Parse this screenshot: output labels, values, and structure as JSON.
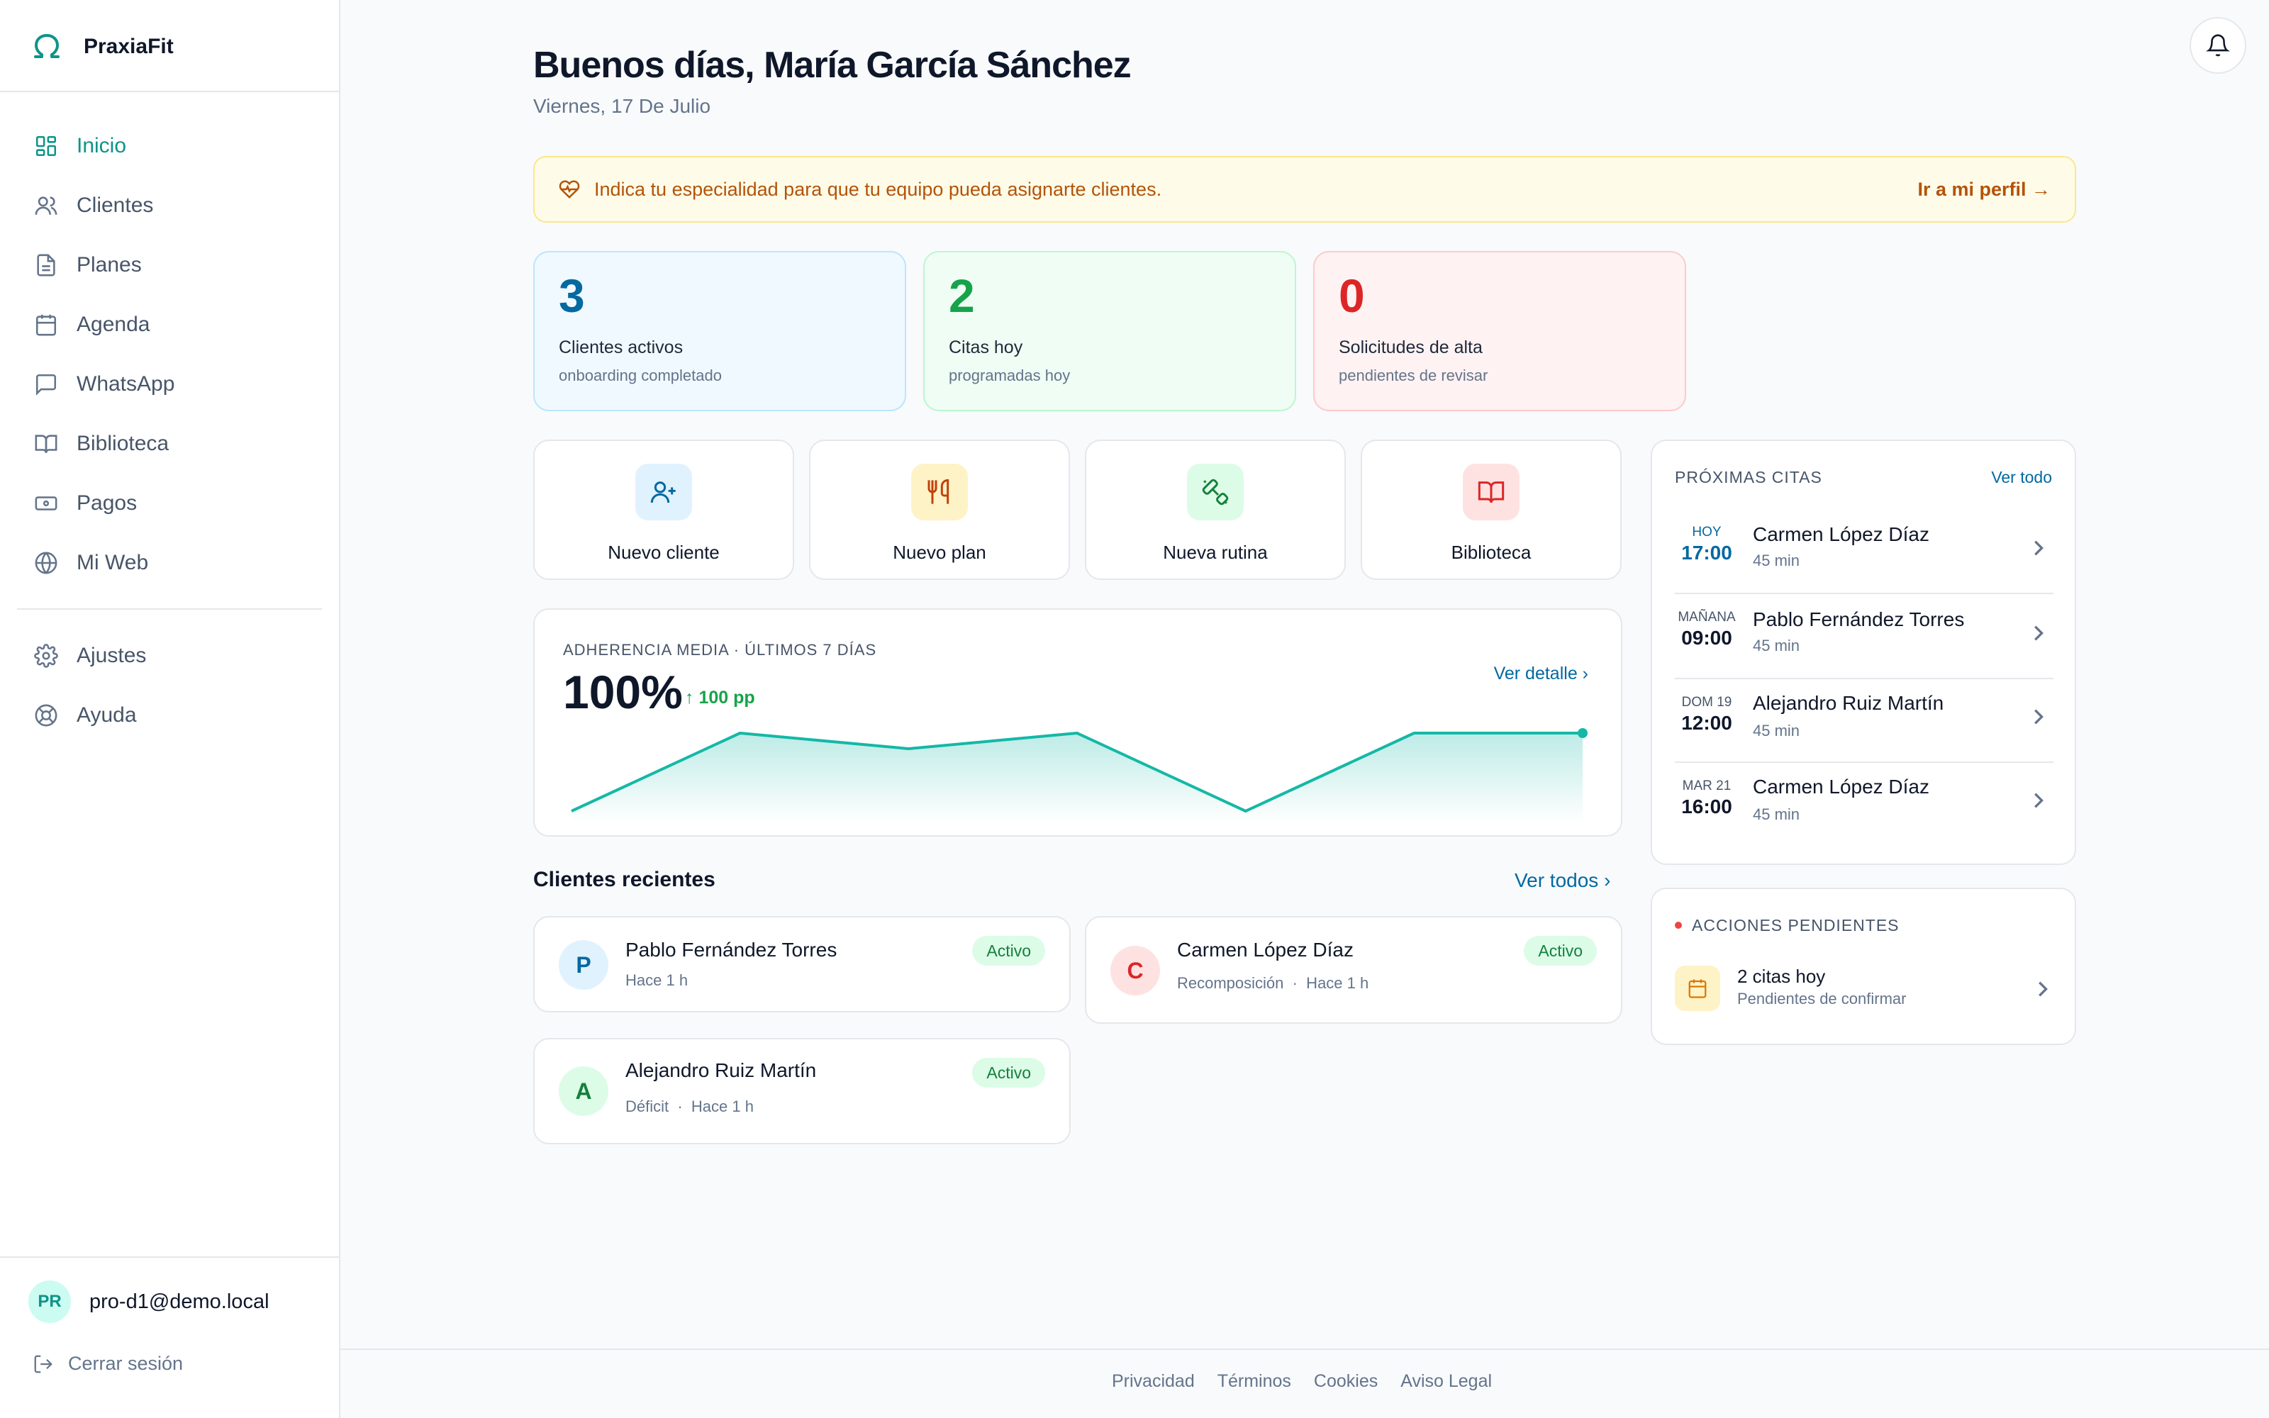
{
  "brand": {
    "name": "PraxiaFit"
  },
  "nav": {
    "items": [
      {
        "label": "Inicio"
      },
      {
        "label": "Clientes"
      },
      {
        "label": "Planes"
      },
      {
        "label": "Agenda"
      },
      {
        "label": "WhatsApp"
      },
      {
        "label": "Biblioteca"
      },
      {
        "label": "Pagos"
      },
      {
        "label": "Mi Web"
      }
    ],
    "secondary": [
      {
        "label": "Ajustes"
      },
      {
        "label": "Ayuda"
      }
    ]
  },
  "user": {
    "initials": "PR",
    "email": "pro-d1@demo.local",
    "logout": "Cerrar sesión"
  },
  "header": {
    "greeting": "Buenos días, María García Sánchez",
    "date": "Viernes, 17 De Julio"
  },
  "banner": {
    "text": "Indica tu especialidad para que tu equipo pueda asignarte clientes.",
    "link": "Ir a mi perfil →"
  },
  "stats": [
    {
      "value": "3",
      "label": "Clientes activos",
      "sub": "onboarding completado",
      "color": "#0369a1"
    },
    {
      "value": "2",
      "label": "Citas hoy",
      "sub": "programadas hoy",
      "color": "#16a34a"
    },
    {
      "value": "0",
      "label": "Solicitudes de alta",
      "sub": "pendientes de revisar",
      "color": "#dc2626"
    }
  ],
  "quick_actions": [
    {
      "label": "Nuevo cliente",
      "icon": "user-plus-icon"
    },
    {
      "label": "Nuevo plan",
      "icon": "utensils-icon"
    },
    {
      "label": "Nueva rutina",
      "icon": "dumbbell-icon"
    },
    {
      "label": "Biblioteca",
      "icon": "book-open-icon"
    }
  ],
  "adherence": {
    "title": "ADHERENCIA MEDIA · ÚLTIMOS 7 DÍAS",
    "value": "100%",
    "delta": "100 pp",
    "link": "Ver detalle"
  },
  "chart_data": {
    "type": "area",
    "title": "ADHERENCIA MEDIA · ÚLTIMOS 7 DÍAS",
    "x": [
      1,
      2,
      3,
      4,
      5,
      6,
      7
    ],
    "values": [
      0,
      100,
      80,
      100,
      0,
      100,
      100
    ],
    "ylim": [
      0,
      100
    ],
    "grid": false,
    "color": "#14b8a6"
  },
  "recent": {
    "title": "Clientes recientes",
    "link": "Ver todos",
    "clients": [
      {
        "initial": "P",
        "name": "Pablo Fernández Torres",
        "meta": "Hace 1 h",
        "status": "Activo"
      },
      {
        "initial": "C",
        "name": "Carmen López Díaz",
        "meta": "Recomposición  ·  Hace 1 h",
        "status": "Activo"
      },
      {
        "initial": "A",
        "name": "Alejandro Ruiz Martín",
        "meta": "Déficit  ·  Hace 1 h",
        "status": "Activo"
      }
    ]
  },
  "appointments": {
    "title": "PRÓXIMAS CITAS",
    "link": "Ver todo",
    "items": [
      {
        "day": "HOY",
        "time": "17:00",
        "name": "Carmen López Díaz",
        "duration": "45 min"
      },
      {
        "day": "MAÑANA",
        "time": "09:00",
        "name": "Pablo Fernández Torres",
        "duration": "45 min"
      },
      {
        "day": "DOM 19",
        "time": "12:00",
        "name": "Alejandro Ruiz Martín",
        "duration": "45 min"
      },
      {
        "day": "MAR 21",
        "time": "16:00",
        "name": "Carmen López Díaz",
        "duration": "45 min"
      }
    ]
  },
  "pending": {
    "title": "ACCIONES PENDIENTES",
    "main": "2 citas hoy",
    "sub": "Pendientes de confirmar"
  },
  "footer": {
    "links": [
      "Privacidad",
      "Términos",
      "Cookies",
      "Aviso Legal"
    ]
  }
}
